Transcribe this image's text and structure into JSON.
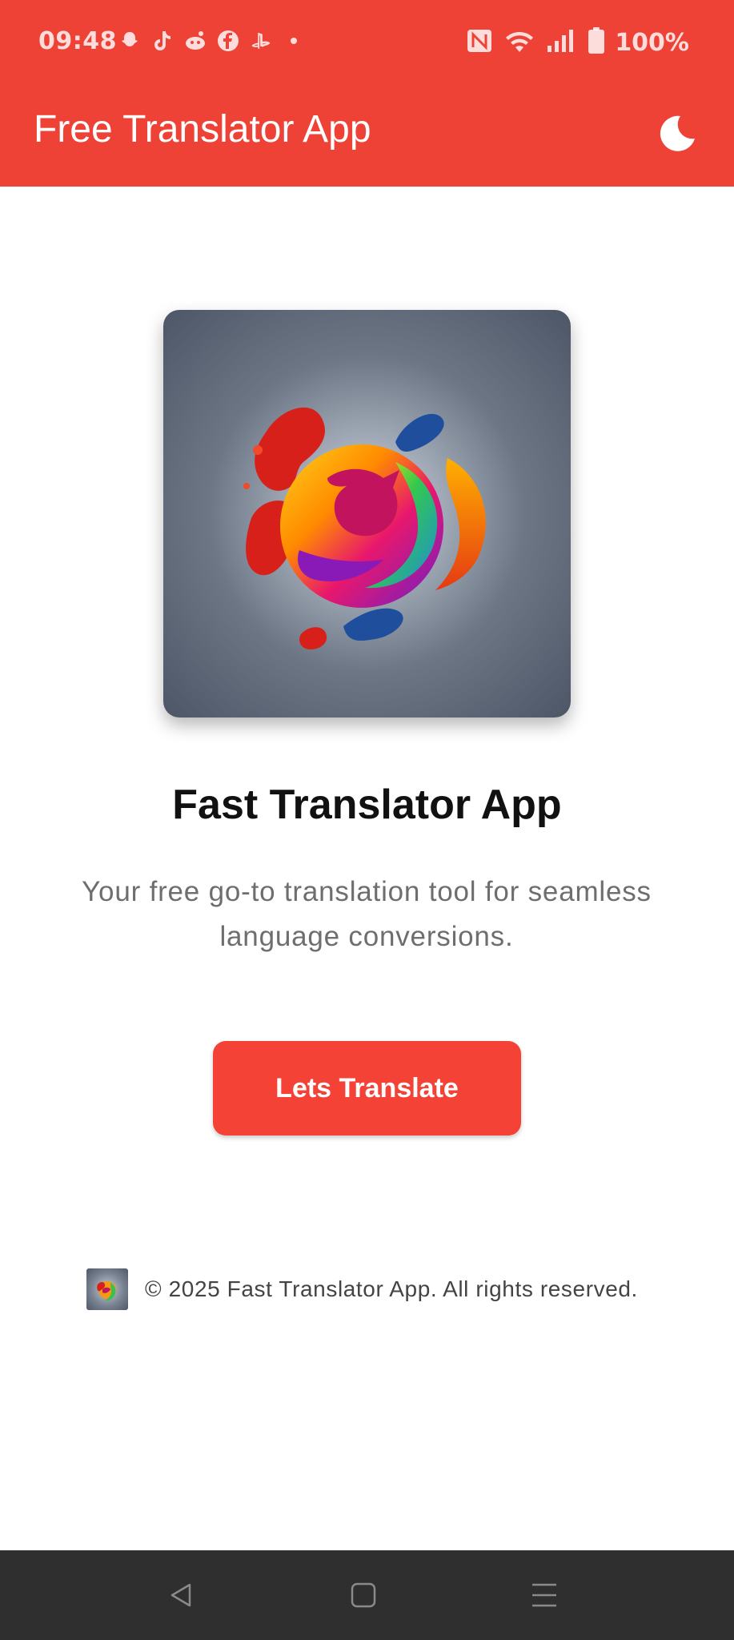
{
  "status_bar": {
    "time": "09:48",
    "battery": "100%",
    "left_icons": [
      "snapchat-icon",
      "tiktok-icon",
      "reddit-icon",
      "facebook-icon",
      "playstation-icon",
      "dot-icon"
    ],
    "right_icons": [
      "nfc-icon",
      "wifi-icon",
      "signal-icon",
      "battery-icon"
    ]
  },
  "app_bar": {
    "title": "Free Translator App",
    "theme_icon": "moon-icon"
  },
  "main": {
    "app_name": "Fast Translator App",
    "tagline": "Your free go-to translation tool for seamless language conversions.",
    "cta_label": "Lets Translate"
  },
  "footer": {
    "text": "© 2025 Fast Translator App. All rights reserved."
  },
  "nav_bar": {
    "buttons": [
      "back-icon",
      "home-icon",
      "menu-icon"
    ]
  },
  "colors": {
    "primary": "#ee4237",
    "button": "#f44336",
    "nav_bg": "#2f2f2f"
  }
}
